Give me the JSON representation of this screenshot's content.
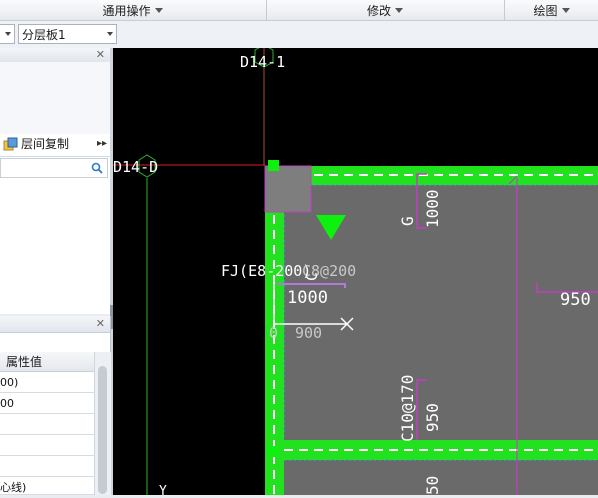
{
  "menu": {
    "items": [
      "通用操作",
      "修改",
      "绘图"
    ]
  },
  "toolbar": {
    "combo_left_value": "",
    "combo_layer": "分层板1"
  },
  "left_panel": {
    "action_label": "层间复制",
    "search_placeholder": ""
  },
  "props_panel": {
    "header_value": "属性值",
    "rows": [
      "00)",
      "00",
      "",
      "",
      "",
      "心线)"
    ]
  },
  "canvas": {
    "axis_top": "D14-1",
    "axis_left": "D14-D",
    "rebar_label": "FJ(E8-200)",
    "rebar_label_ghost": "C8@200",
    "dim_1000_a": "1000",
    "dim_900": "900",
    "dim_0": "0",
    "letter_c": "C",
    "letter_g": "G",
    "dim_1000_vert": "1000",
    "dim_950_right": "950",
    "dim_c10": "C10@170",
    "dim_950_vert": "950",
    "dim_50_bottom": "50",
    "letter_y": "Y"
  },
  "colors": {
    "slab_fill": "#6a6a6a",
    "beam_green": "#22e11e",
    "dim_magenta": "#c23fc2",
    "axis_red": "#e01c1c",
    "marker_green": "#0ef00e"
  }
}
